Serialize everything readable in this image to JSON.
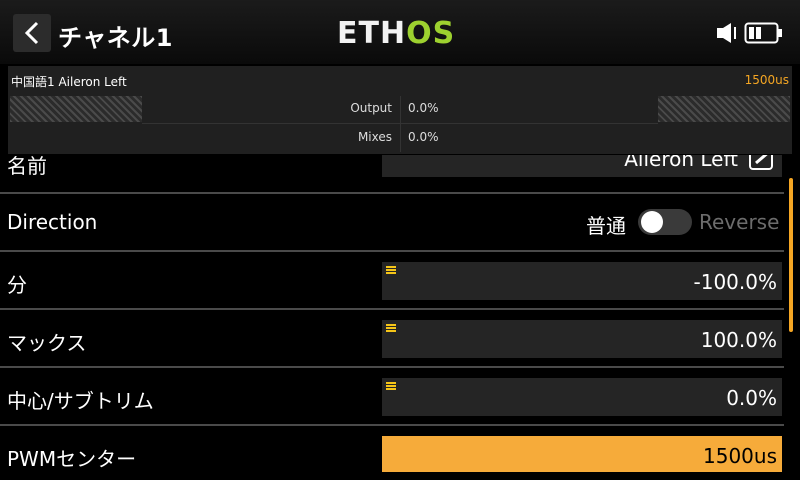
{
  "header": {
    "title": "チャネル1",
    "logo_main": "ETH",
    "logo_accent": "OS"
  },
  "monitor": {
    "channel_name": "中国語1  Aileron Left",
    "value": "1500us",
    "output_label": "Output",
    "output_value": "0.0%",
    "mixes_label": "Mixes",
    "mixes_value": "0.0%"
  },
  "settings": {
    "name": {
      "label": "名前",
      "value": "Aileron Left"
    },
    "direction": {
      "label": "Direction",
      "normal": "普通",
      "reverse": "Reverse"
    },
    "min": {
      "label": "分",
      "value": "-100.0%"
    },
    "max": {
      "label": "マックス",
      "value": "100.0%"
    },
    "center": {
      "label": "中心/サブトリム",
      "value": "0.0%"
    },
    "pwm": {
      "label": "PWMセンター",
      "value": "1500us"
    }
  },
  "colors": {
    "accent": "#f6ab3a",
    "logo_green": "#9dd12f"
  }
}
